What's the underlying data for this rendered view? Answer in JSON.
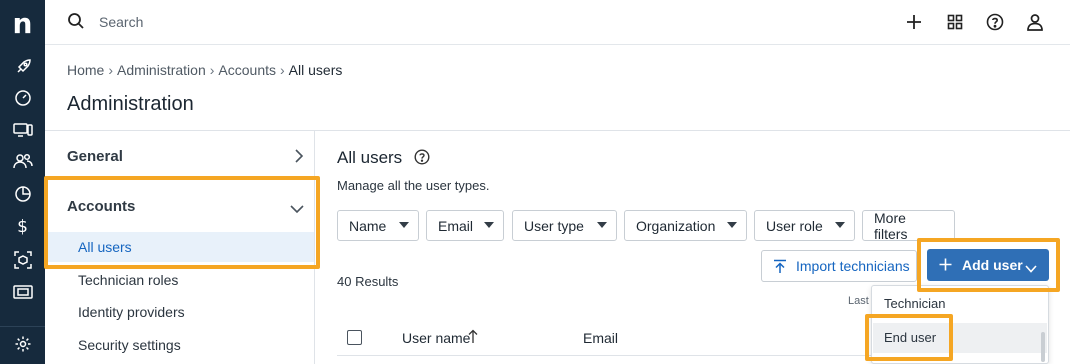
{
  "rail": {
    "logo": "n",
    "icons": [
      "rocket-icon",
      "dashboard-gauge-icon",
      "devices-icon",
      "users-group-icon",
      "pie-chart-icon",
      "dollar-icon",
      "package-box-icon",
      "ticket-icon",
      "settings-gear-icon"
    ]
  },
  "topbar": {
    "search_placeholder": "Search",
    "icons": [
      "plus-icon",
      "apps-grid-icon",
      "help-icon",
      "user-profile-icon"
    ]
  },
  "breadcrumb": [
    "Home",
    "Administration",
    "Accounts",
    "All users"
  ],
  "page_title": "Administration",
  "nav": {
    "general": "General",
    "accounts": "Accounts",
    "sub_items": [
      "All users",
      "Technician roles",
      "Identity providers",
      "Security settings"
    ],
    "active_index": 0
  },
  "main": {
    "title": "All users",
    "subtitle": "Manage all the user types.",
    "filters": [
      "Name",
      "Email",
      "User type",
      "Organization",
      "User role"
    ],
    "more_filters": "More filters",
    "import_label": "Import technicians",
    "add_label": "Add user",
    "results": "40 Results",
    "last_label": "Last",
    "columns": [
      "User name",
      "Email"
    ]
  },
  "menu": {
    "items": [
      "Technician",
      "End user"
    ],
    "highlighted_index": 1
  },
  "colors": {
    "rail_bg": "#162a3d",
    "accent": "#2f6fb6",
    "link": "#1565c0",
    "highlight_frame": "#f5a623"
  }
}
